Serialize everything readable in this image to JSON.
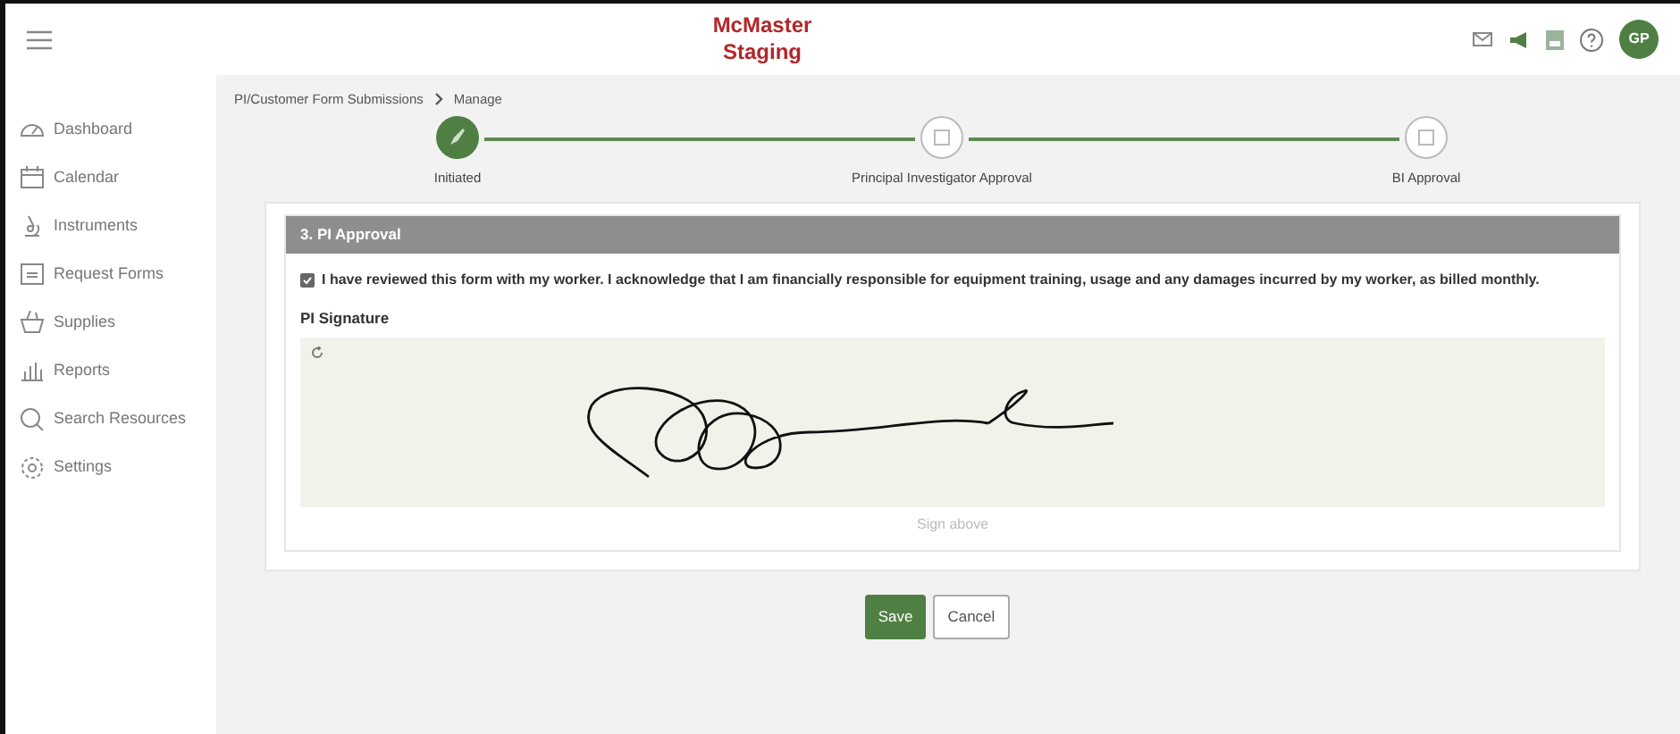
{
  "header": {
    "title": "McMaster",
    "subtitle": "Staging",
    "avatar": "GP"
  },
  "sidebar": {
    "items": [
      {
        "label": "Dashboard",
        "kind": "gauge"
      },
      {
        "label": "Calendar",
        "kind": "calendar"
      },
      {
        "label": "Instruments",
        "kind": "microscope"
      },
      {
        "label": "Request Forms",
        "kind": "form"
      },
      {
        "label": "Supplies",
        "kind": "basket"
      },
      {
        "label": "Reports",
        "kind": "chart"
      },
      {
        "label": "Search Resources",
        "kind": "search"
      },
      {
        "label": "Settings",
        "kind": "gear"
      }
    ]
  },
  "breadcrumb": [
    "PI/Customer Form Submissions",
    "Manage"
  ],
  "steps": [
    {
      "label": "Initiated",
      "done": true
    },
    {
      "label": "Principal Investigator Approval",
      "done": false
    },
    {
      "label": "BI Approval",
      "done": false
    }
  ],
  "section": {
    "title": "3. PI Approval",
    "agreement": {
      "checked": true,
      "text": "I have reviewed this form with my worker. I acknowledge that I am financially responsible for equipment training, usage and any damages incurred by my worker, as billed monthly."
    },
    "signature_label": "PI Signature",
    "signature_hint": "Sign above"
  },
  "buttons": [
    {
      "label": "Save",
      "kind": "primary"
    },
    {
      "label": "Cancel",
      "kind": "secondary"
    }
  ]
}
